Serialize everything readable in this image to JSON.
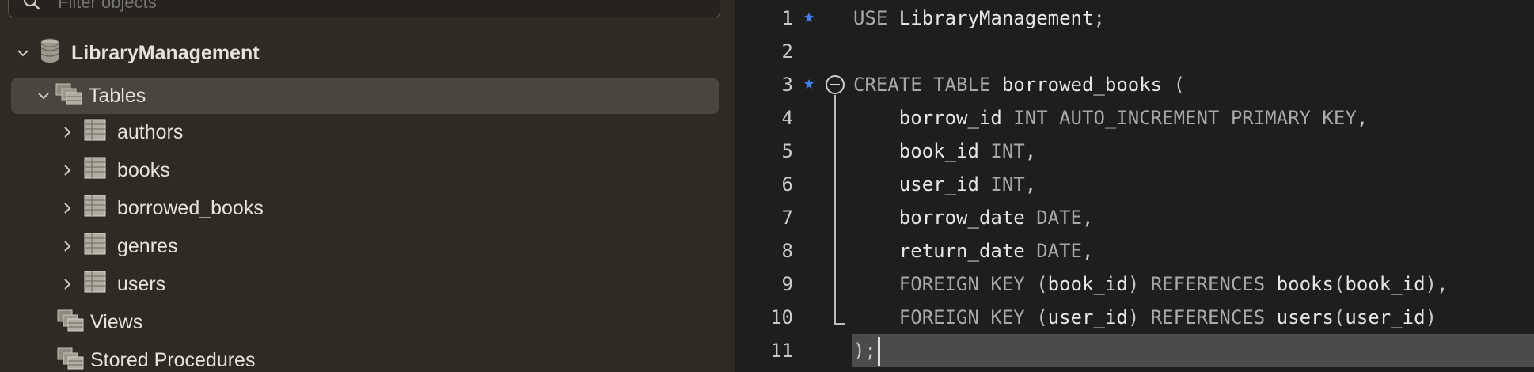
{
  "navigator": {
    "filter_placeholder": "Filter objects",
    "database": {
      "name": "LibraryManagement",
      "expanded": true
    },
    "tables_group": {
      "label": "Tables",
      "expanded": true,
      "selected": true
    },
    "tables": [
      {
        "name": "authors"
      },
      {
        "name": "books"
      },
      {
        "name": "borrowed_books"
      },
      {
        "name": "genres"
      },
      {
        "name": "users"
      }
    ],
    "views_label": "Views",
    "procedures_label": "Stored Procedures"
  },
  "editor": {
    "lines": [
      {
        "num": "1",
        "tokens": [
          [
            "kw",
            "USE"
          ],
          [
            "id",
            " LibraryManagement"
          ],
          [
            "punct",
            ";"
          ]
        ],
        "marker": true
      },
      {
        "num": "2",
        "tokens": []
      },
      {
        "num": "3",
        "tokens": [
          [
            "kw",
            "CREATE TABLE"
          ],
          [
            "id",
            " borrowed_books"
          ],
          [
            "punct",
            " ("
          ]
        ],
        "marker": true,
        "fold": true
      },
      {
        "num": "4",
        "tokens": [
          [
            "id",
            "    borrow_id"
          ],
          [
            "kw",
            " INT AUTO_INCREMENT PRIMARY KEY"
          ],
          [
            "punct",
            ","
          ]
        ]
      },
      {
        "num": "5",
        "tokens": [
          [
            "id",
            "    book_id"
          ],
          [
            "kw",
            " INT"
          ],
          [
            "punct",
            ","
          ]
        ]
      },
      {
        "num": "6",
        "tokens": [
          [
            "id",
            "    user_id"
          ],
          [
            "kw",
            " INT"
          ],
          [
            "punct",
            ","
          ]
        ]
      },
      {
        "num": "7",
        "tokens": [
          [
            "id",
            "    borrow_date"
          ],
          [
            "kw",
            " DATE"
          ],
          [
            "punct",
            ","
          ]
        ]
      },
      {
        "num": "8",
        "tokens": [
          [
            "id",
            "    return_date"
          ],
          [
            "kw",
            " DATE"
          ],
          [
            "punct",
            ","
          ]
        ]
      },
      {
        "num": "9",
        "tokens": [
          [
            "kw",
            "    FOREIGN KEY"
          ],
          [
            "punct",
            " ("
          ],
          [
            "id",
            "book_id"
          ],
          [
            "punct",
            ")"
          ],
          [
            "kw",
            " REFERENCES"
          ],
          [
            "id",
            " books"
          ],
          [
            "punct",
            "("
          ],
          [
            "id",
            "book_id"
          ],
          [
            "punct",
            "),"
          ]
        ]
      },
      {
        "num": "10",
        "tokens": [
          [
            "kw",
            "    FOREIGN KEY"
          ],
          [
            "punct",
            " ("
          ],
          [
            "id",
            "user_id"
          ],
          [
            "punct",
            ")"
          ],
          [
            "kw",
            " REFERENCES"
          ],
          [
            "id",
            " users"
          ],
          [
            "punct",
            "("
          ],
          [
            "id",
            "user_id"
          ],
          [
            "punct",
            ")"
          ]
        ]
      },
      {
        "num": "11",
        "tokens": [
          [
            "punct",
            ");"
          ]
        ],
        "current": true
      }
    ],
    "colors": {
      "marker": "#3b82f6",
      "current_line": "#4b4b4b",
      "keyword": "#a9a9a9",
      "identifier": "#e6e6e6"
    }
  }
}
